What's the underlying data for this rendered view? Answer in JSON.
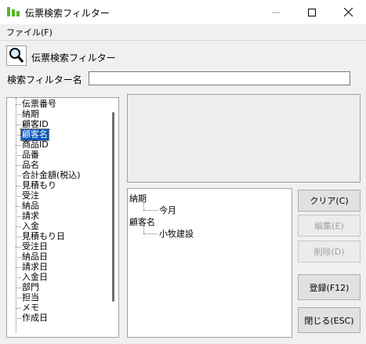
{
  "window": {
    "title": "伝票検索フィルター",
    "minimize_icon": "minimize-icon",
    "maximize_icon": "maximize-icon",
    "close_icon": "close-icon"
  },
  "menu": {
    "file": "ファイル(F)"
  },
  "header": {
    "title": "伝票検索フィルター",
    "icon": "magnifier-icon"
  },
  "filter_name": {
    "label": "検索フィルター名",
    "value": ""
  },
  "field_tree": {
    "items": [
      {
        "label": "伝票番号",
        "selected": false
      },
      {
        "label": "納期",
        "selected": false
      },
      {
        "label": "顧客ID",
        "selected": false
      },
      {
        "label": "顧客名",
        "selected": true
      },
      {
        "label": "商品ID",
        "selected": false
      },
      {
        "label": "品番",
        "selected": false
      },
      {
        "label": "品名",
        "selected": false
      },
      {
        "label": "合計金額(税込)",
        "selected": false
      },
      {
        "label": "見積もり",
        "selected": false
      },
      {
        "label": "受注",
        "selected": false
      },
      {
        "label": "納品",
        "selected": false
      },
      {
        "label": "請求",
        "selected": false
      },
      {
        "label": "入金",
        "selected": false
      },
      {
        "label": "見積もり日",
        "selected": false
      },
      {
        "label": "受注日",
        "selected": false
      },
      {
        "label": "納品日",
        "selected": false
      },
      {
        "label": "請求日",
        "selected": false
      },
      {
        "label": "入金日",
        "selected": false
      },
      {
        "label": "部門",
        "selected": false
      },
      {
        "label": "担当",
        "selected": false
      },
      {
        "label": "メモ",
        "selected": false
      },
      {
        "label": "作成日",
        "selected": false
      }
    ]
  },
  "conditions": [
    {
      "field": "納期",
      "value": "今月"
    },
    {
      "field": "顧客名",
      "value": "小牧建設"
    }
  ],
  "buttons": {
    "clear": "クリア(C)",
    "edit": "編集(E)",
    "delete": "削除(D)",
    "register": "登録(F12)",
    "close": "閉じる(ESC)"
  }
}
